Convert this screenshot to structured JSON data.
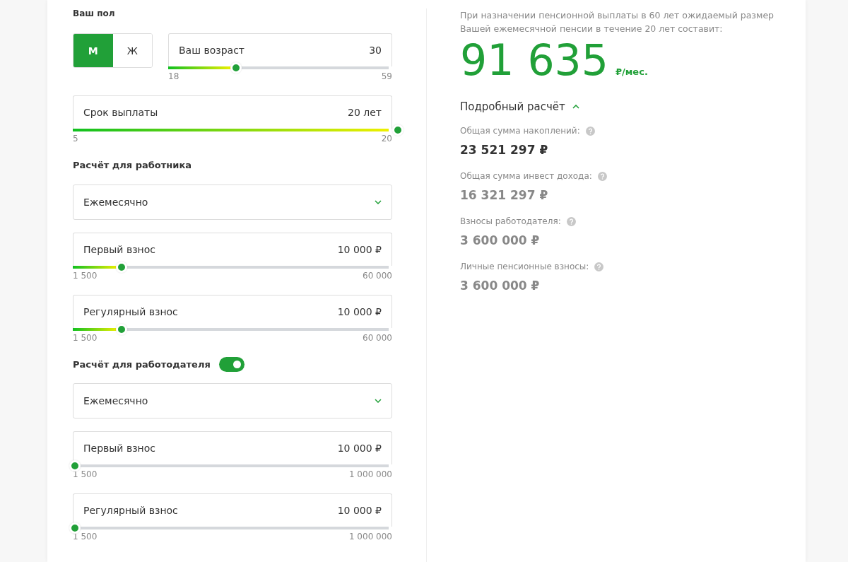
{
  "gender": {
    "label": "Ваш пол",
    "options": [
      {
        "label": "М",
        "selected": true
      },
      {
        "label": "Ж",
        "selected": false
      }
    ]
  },
  "age": {
    "label": "Ваш возраст",
    "value": "30",
    "level": 0.29,
    "min": "18",
    "max": "59"
  },
  "form": [
    {
      "kind": "slider",
      "label": "Срок выплаты",
      "value": "20 лет",
      "level": 1.0,
      "min": "5",
      "max": "20"
    },
    {
      "kind": "heading",
      "label": "Расчёт для работника"
    },
    {
      "kind": "select",
      "value": "Ежемесячно"
    },
    {
      "kind": "slider",
      "label": "Первый взнос",
      "value": "10 000 ₽",
      "level": 0.144,
      "min": "1 500",
      "max": "60 000"
    },
    {
      "kind": "slider",
      "label": "Регулярный взнос",
      "value": "10 000 ₽",
      "level": 0.144,
      "min": "1 500",
      "max": "60 000"
    },
    {
      "kind": "toggle",
      "label": "Расчёт для работодателя",
      "on": true
    },
    {
      "kind": "select",
      "value": "Ежемесячно"
    },
    {
      "kind": "slider",
      "label": "Первый взнос",
      "value": "10 000 ₽",
      "level": 0,
      "min": "1 500",
      "max": "1 000 000"
    },
    {
      "kind": "slider",
      "label": "Регулярный взнос",
      "value": "10 000 ₽",
      "level": 0,
      "min": "1 500",
      "max": "1 000 000"
    }
  ],
  "result": {
    "intro": "При назначении пенсионной выплаты в 60 лет ожидаемый размер Вашей ежемесячной пенсии в течение 20 лет составит:",
    "amount": "91 635",
    "unit": "₽/мес.",
    "details": {
      "label": "Подробный расчёт",
      "expanded": true,
      "items": [
        {
          "label": "Общая сумма накоплений:",
          "value": "23 521 297 ₽",
          "highlighted": true
        },
        {
          "label": "Общая сумма инвест дохода:",
          "value": "16 321 297 ₽",
          "highlighted": false
        },
        {
          "label": "Взносы работодателя:",
          "value": "3 600 000 ₽",
          "highlighted": false
        },
        {
          "label": "Личные пенсионные взносы:",
          "value": "3 600 000 ₽",
          "highlighted": false
        }
      ]
    }
  }
}
